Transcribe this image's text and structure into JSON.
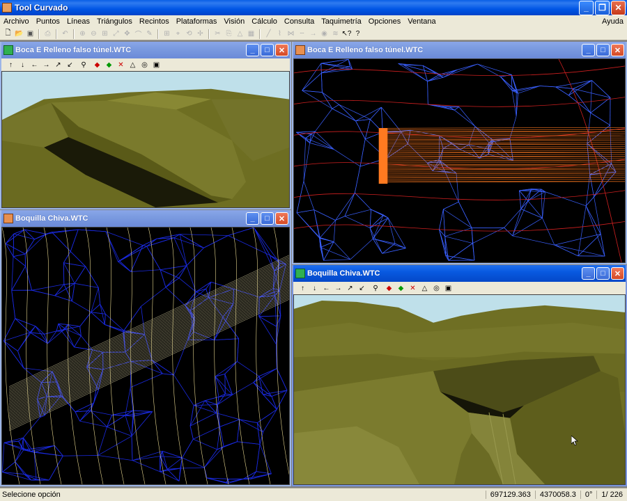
{
  "app": {
    "title": "Tool Curvado",
    "minimize": "_",
    "restore": "❐",
    "close": "✕"
  },
  "menu": {
    "items": [
      "Archivo",
      "Puntos",
      "Líneas",
      "Triángulos",
      "Recintos",
      "Plataformas",
      "Visión",
      "Cálculo",
      "Consulta",
      "Taquimetría",
      "Opciones",
      "Ventana"
    ],
    "help": "Ayuda"
  },
  "toolbar": {
    "icons": [
      "new-icon",
      "open-icon",
      "save-icon",
      "print-icon",
      "undo-icon",
      "zoom-in-icon",
      "zoom-out-icon",
      "zoom-window-icon",
      "zoom-extents-icon",
      "pan-icon",
      "measure-icon",
      "pencil-icon",
      "grid-icon",
      "snap-icon",
      "rotate-icon",
      "move-icon",
      "cut-icon",
      "paste-icon",
      "triangle-icon",
      "line-icon",
      "polyline-icon",
      "arrow-icon",
      "eye-icon",
      "help-pointer-icon",
      "help-icon"
    ]
  },
  "windows": [
    {
      "id": "w1",
      "title": "Boca E Relleno falso túnel.WTC",
      "type": "3d",
      "active": false,
      "tools": [
        "↑",
        "↓",
        "←",
        "→",
        "↗",
        "↙",
        "⚲",
        "■",
        "■",
        "✕",
        "⌂",
        "◎",
        "💾"
      ]
    },
    {
      "id": "w2",
      "title": "Boca E Relleno falso túnel.WTC",
      "type": "wireframe",
      "active": false
    },
    {
      "id": "w3",
      "title": "Boquilla Chiva.WTC",
      "type": "plan",
      "active": false
    },
    {
      "id": "w4",
      "title": "Boquilla Chiva.WTC",
      "type": "3d",
      "active": true,
      "tools": [
        "↑",
        "↓",
        "←",
        "→",
        "↗",
        "↙",
        "⚲",
        "■",
        "■",
        "✕",
        "⌂",
        "◎",
        "💾"
      ]
    }
  ],
  "status": {
    "message": "Selecione opción",
    "x": "697129.363",
    "y": "4370058.3",
    "angle": "0°",
    "page": "1/ 226"
  },
  "colors": {
    "terrain": "#7a7a2a",
    "sky": "#bfe0ea",
    "wire_blue": "#2030ff",
    "wire_red": "#d02020",
    "plan_yellow": "#e8d890"
  }
}
